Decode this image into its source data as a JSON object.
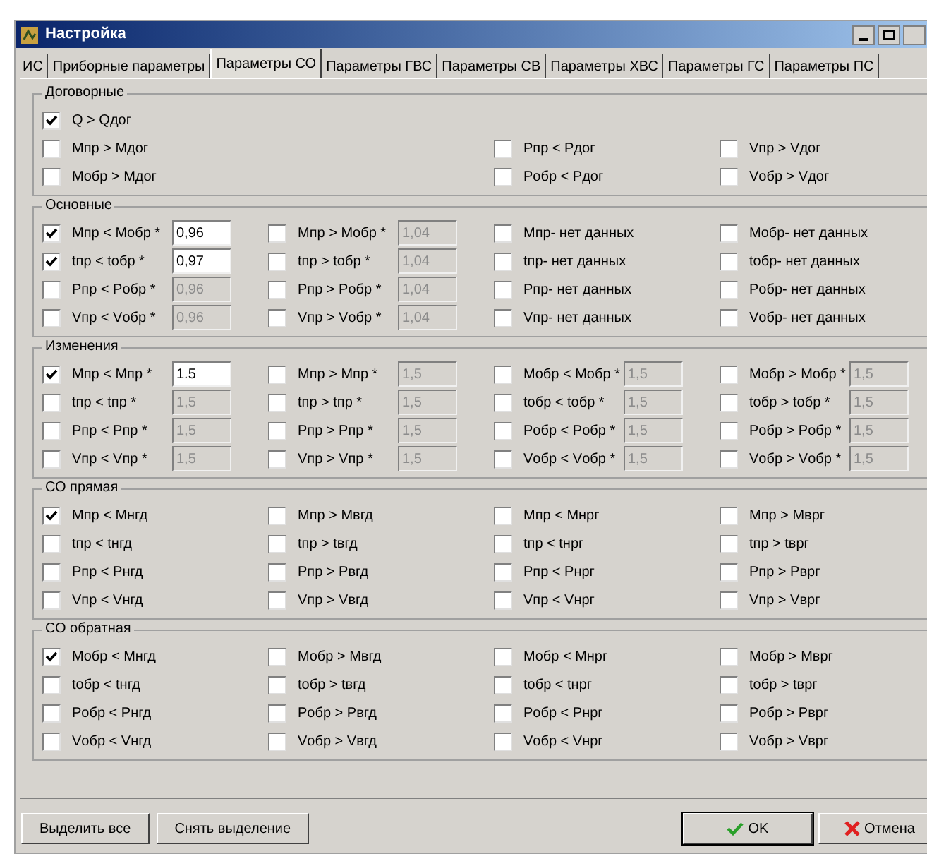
{
  "window": {
    "title": "Настройка"
  },
  "tabs": [
    {
      "label": "ИС",
      "selected": false
    },
    {
      "label": "Приборные параметры",
      "selected": false
    },
    {
      "label": "Параметры СО",
      "selected": true
    },
    {
      "label": "Параметры ГВС",
      "selected": false
    },
    {
      "label": "Параметры СВ",
      "selected": false
    },
    {
      "label": "Параметры ХВС",
      "selected": false
    },
    {
      "label": "Параметры ГС",
      "selected": false
    },
    {
      "label": "Параметры ПС",
      "selected": false
    }
  ],
  "groups": [
    {
      "title": "Договорные",
      "rows": [
        [
          {
            "label": "Q > Qдог",
            "checked": true
          },
          null,
          null,
          null
        ],
        [
          {
            "label": "Mпр > Mдог",
            "checked": false
          },
          null,
          {
            "label": "Pпр < Pдог",
            "checked": false
          },
          {
            "label": "Vпр > Vдог",
            "checked": false
          }
        ],
        [
          {
            "label": "Mобр > Mдог",
            "checked": false
          },
          null,
          {
            "label": "Pобр < Pдог",
            "checked": false
          },
          {
            "label": "Vобр > Vдог",
            "checked": false
          }
        ]
      ]
    },
    {
      "title": "Основные",
      "rows": [
        [
          {
            "label": "Mпр < Mобр *",
            "checked": true,
            "value": "0,96",
            "enabled": true
          },
          {
            "label": "Mпр > Mобр *",
            "checked": false,
            "value": "1,04",
            "enabled": false
          },
          {
            "label": "Mпр- нет данных",
            "checked": false
          },
          {
            "label": "Mобр- нет данных",
            "checked": false
          }
        ],
        [
          {
            "label": "tпр < tобр *",
            "checked": true,
            "value": "0,97",
            "enabled": true
          },
          {
            "label": "tпр > tобр *",
            "checked": false,
            "value": "1,04",
            "enabled": false
          },
          {
            "label": "tпр- нет данных",
            "checked": false
          },
          {
            "label": "tобр- нет данных",
            "checked": false
          }
        ],
        [
          {
            "label": "Pпр < Pобр *",
            "checked": false,
            "value": "0,96",
            "enabled": false
          },
          {
            "label": "Pпр > Pобр *",
            "checked": false,
            "value": "1,04",
            "enabled": false
          },
          {
            "label": "Pпр- нет данных",
            "checked": false
          },
          {
            "label": "Pобр- нет данных",
            "checked": false
          }
        ],
        [
          {
            "label": "Vпр < Vобр *",
            "checked": false,
            "value": "0,96",
            "enabled": false
          },
          {
            "label": "Vпр > Vобр *",
            "checked": false,
            "value": "1,04",
            "enabled": false
          },
          {
            "label": "Vпр- нет данных",
            "checked": false
          },
          {
            "label": "Vобр- нет данных",
            "checked": false
          }
        ]
      ]
    },
    {
      "title": "Изменения",
      "rows": [
        [
          {
            "label": "Mпр < Mпр *",
            "checked": true,
            "value": "1.5",
            "enabled": true
          },
          {
            "label": "Mпр > Mпр *",
            "checked": false,
            "value": "1,5",
            "enabled": false
          },
          {
            "label": "Mобр < Mобр *",
            "checked": false,
            "value": "1,5",
            "enabled": false
          },
          {
            "label": "Mобр > Mобр *",
            "checked": false,
            "value": "1,5",
            "enabled": false
          }
        ],
        [
          {
            "label": "tпр < tпр *",
            "checked": false,
            "value": "1,5",
            "enabled": false
          },
          {
            "label": "tпр > tпр *",
            "checked": false,
            "value": "1,5",
            "enabled": false
          },
          {
            "label": "tобр < tобр *",
            "checked": false,
            "value": "1,5",
            "enabled": false
          },
          {
            "label": "tобр > tобр *",
            "checked": false,
            "value": "1,5",
            "enabled": false
          }
        ],
        [
          {
            "label": "Pпр < Pпр *",
            "checked": false,
            "value": "1,5",
            "enabled": false
          },
          {
            "label": "Pпр > Pпр *",
            "checked": false,
            "value": "1,5",
            "enabled": false
          },
          {
            "label": "Pобр < Pобр *",
            "checked": false,
            "value": "1,5",
            "enabled": false
          },
          {
            "label": "Pобр > Pобр *",
            "checked": false,
            "value": "1,5",
            "enabled": false
          }
        ],
        [
          {
            "label": "Vпр < Vпр *",
            "checked": false,
            "value": "1,5",
            "enabled": false
          },
          {
            "label": "Vпр > Vпр *",
            "checked": false,
            "value": "1,5",
            "enabled": false
          },
          {
            "label": "Vобр < Vобр *",
            "checked": false,
            "value": "1,5",
            "enabled": false
          },
          {
            "label": "Vобр > Vобр *",
            "checked": false,
            "value": "1,5",
            "enabled": false
          }
        ]
      ]
    },
    {
      "title": "СО прямая",
      "rows": [
        [
          {
            "label": "Mпр < Mнгд",
            "checked": true
          },
          {
            "label": "Mпр > Mвгд",
            "checked": false
          },
          {
            "label": "Mпр < Mнрг",
            "checked": false
          },
          {
            "label": "Mпр > Mврг",
            "checked": false
          }
        ],
        [
          {
            "label": "tпр < tнгд",
            "checked": false
          },
          {
            "label": "tпр > tвгд",
            "checked": false
          },
          {
            "label": "tпр < tнрг",
            "checked": false
          },
          {
            "label": "tпр > tврг",
            "checked": false
          }
        ],
        [
          {
            "label": "Pпр < Pнгд",
            "checked": false
          },
          {
            "label": "Pпр > Pвгд",
            "checked": false
          },
          {
            "label": "Pпр < Pнрг",
            "checked": false
          },
          {
            "label": "Pпр > Pврг",
            "checked": false
          }
        ],
        [
          {
            "label": "Vпр < Vнгд",
            "checked": false
          },
          {
            "label": "Vпр > Vвгд",
            "checked": false
          },
          {
            "label": "Vпр < Vнрг",
            "checked": false
          },
          {
            "label": "Vпр > Vврг",
            "checked": false
          }
        ]
      ]
    },
    {
      "title": "СО обратная",
      "rows": [
        [
          {
            "label": "Mобр < Mнгд",
            "checked": true
          },
          {
            "label": "Mобр > Mвгд",
            "checked": false
          },
          {
            "label": "Mобр < Mнрг",
            "checked": false
          },
          {
            "label": "Mобр > Mврг",
            "checked": false
          }
        ],
        [
          {
            "label": "tобр < tнгд",
            "checked": false
          },
          {
            "label": "tобр > tвгд",
            "checked": false
          },
          {
            "label": "tобр < tнрг",
            "checked": false
          },
          {
            "label": "tобр > tврг",
            "checked": false
          }
        ],
        [
          {
            "label": "Pобр < Pнгд",
            "checked": false
          },
          {
            "label": "Pобр > Pвгд",
            "checked": false
          },
          {
            "label": "Pобр < Pнрг",
            "checked": false
          },
          {
            "label": "Pобр > Pврг",
            "checked": false
          }
        ],
        [
          {
            "label": "Vобр < Vнгд",
            "checked": false
          },
          {
            "label": "Vобр > Vвгд",
            "checked": false
          },
          {
            "label": "Vобр < Vнрг",
            "checked": false
          },
          {
            "label": "Vобр > Vврг",
            "checked": false
          }
        ]
      ]
    }
  ],
  "buttons_left": [
    {
      "label": "Выделить все"
    },
    {
      "label": "Снять выделение"
    }
  ],
  "buttons_right": [
    {
      "label": "OK",
      "kind": "ok"
    },
    {
      "label": "Отмена",
      "kind": "cancel"
    }
  ]
}
